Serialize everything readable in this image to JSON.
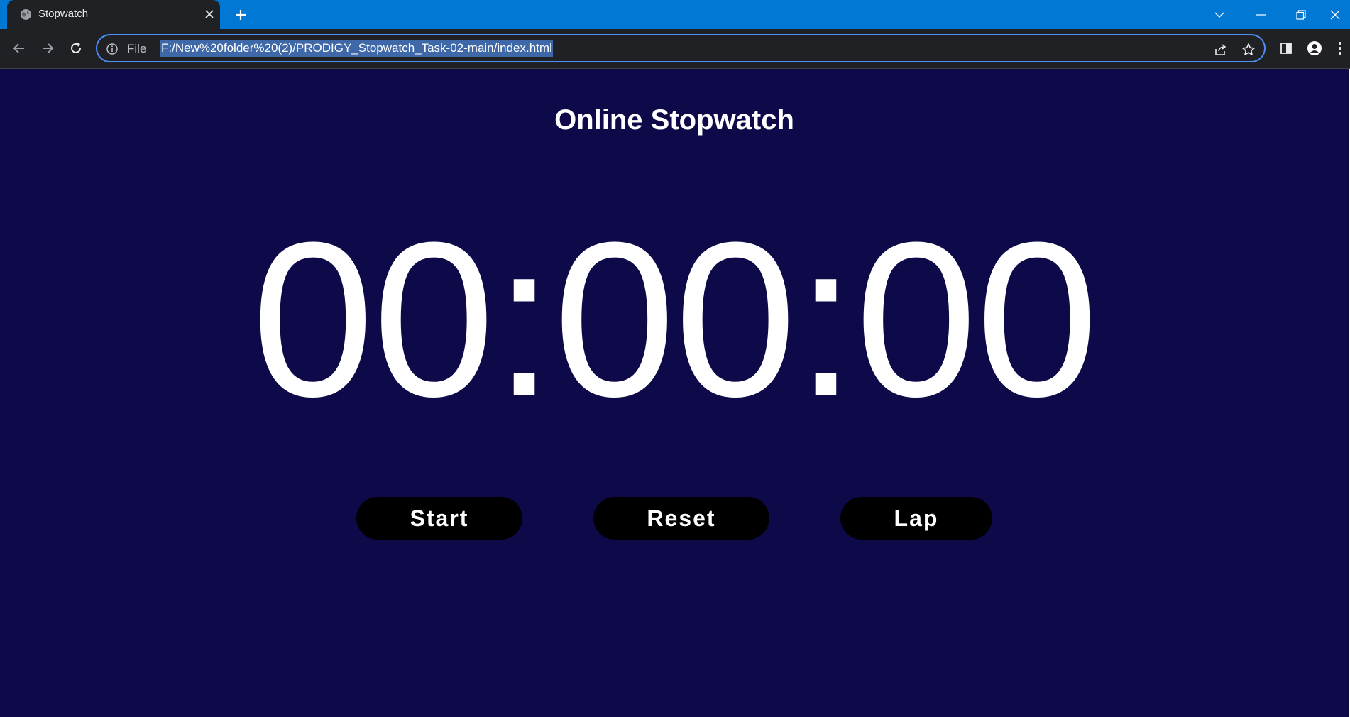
{
  "browser": {
    "tab_title": "Stopwatch",
    "address_chip": "File",
    "url": "F:/New%20folder%20(2)/PRODIGY_Stopwatch_Task-02-main/index.html",
    "accent_color": "#0078d4"
  },
  "page": {
    "heading": "Online Stopwatch",
    "time_display": "00:00:00",
    "background_color": "#0e0a4a",
    "buttons": {
      "start": "Start",
      "reset": "Reset",
      "lap": "Lap"
    }
  }
}
